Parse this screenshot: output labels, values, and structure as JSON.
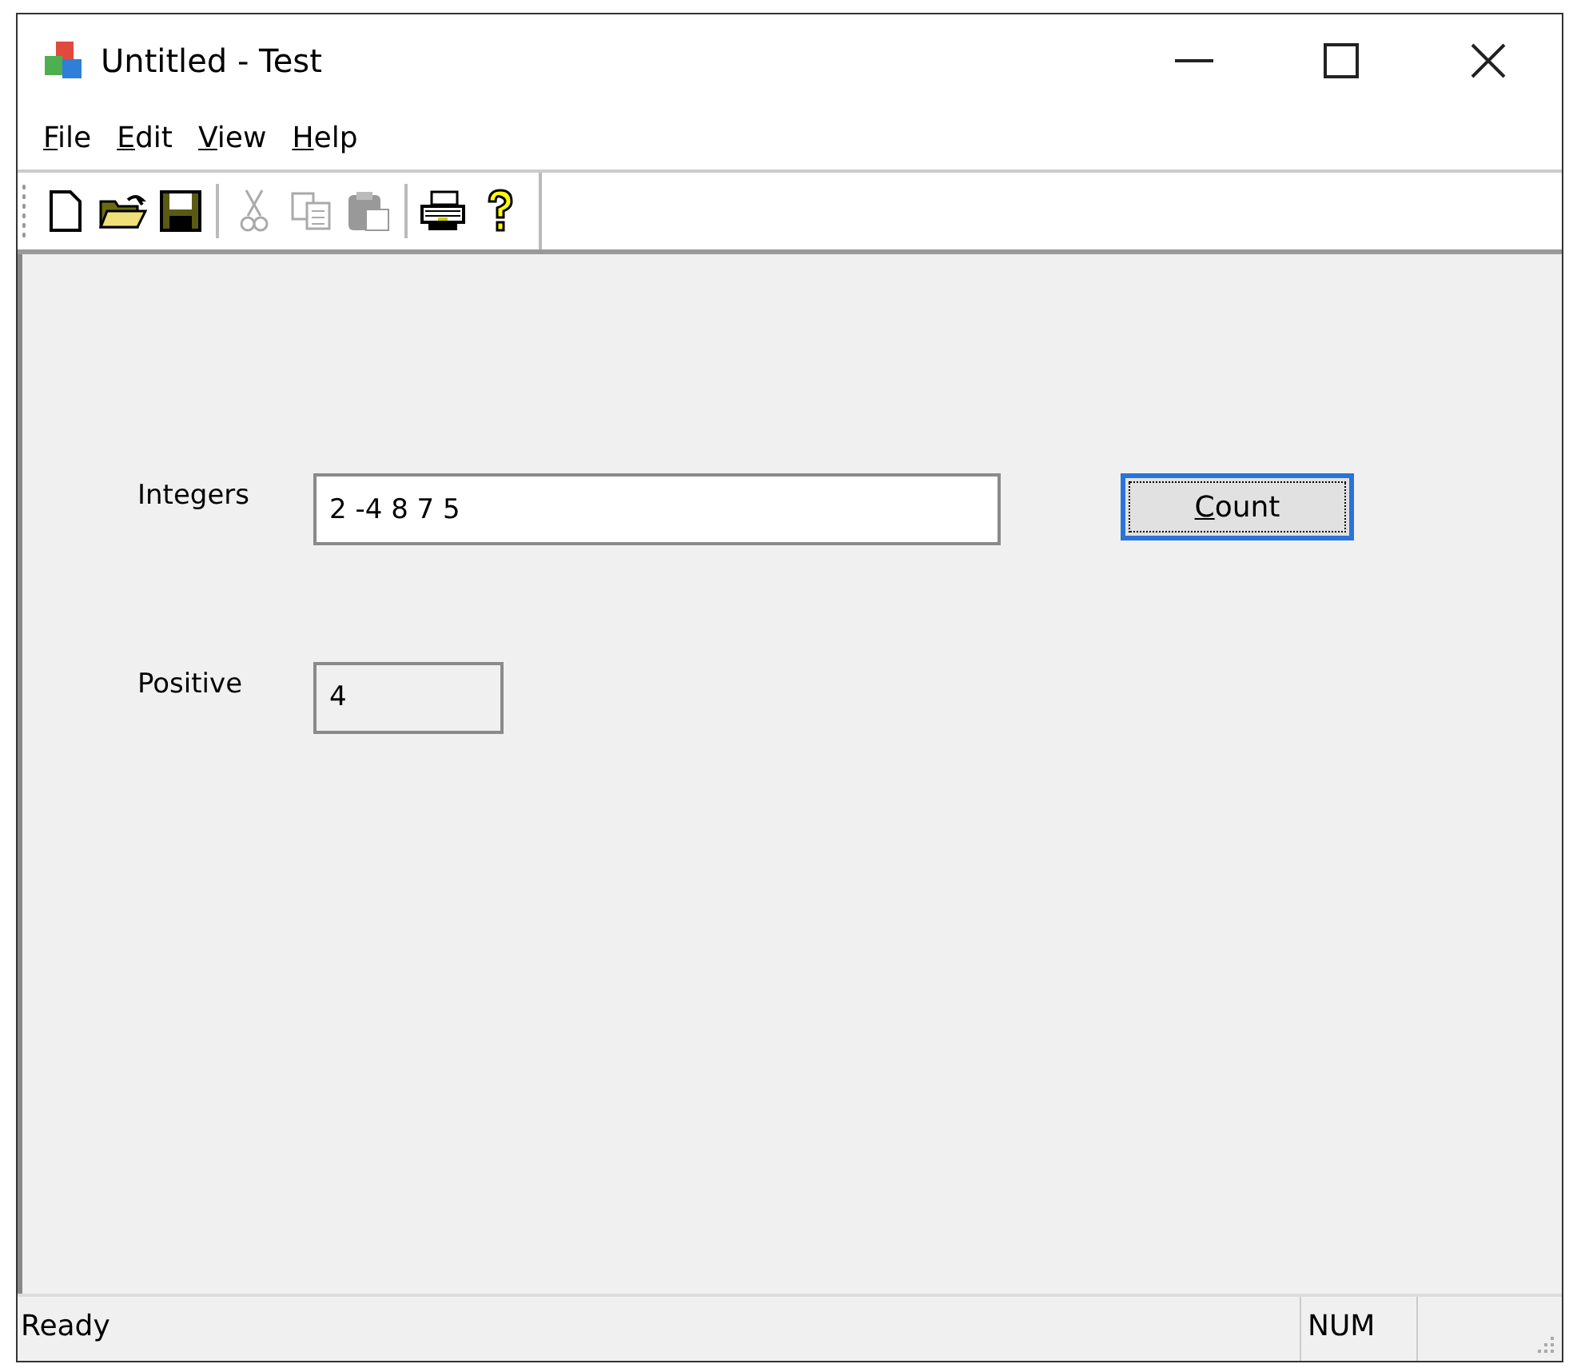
{
  "window": {
    "title": "Untitled - Test"
  },
  "menu": [
    {
      "accel": "F",
      "rest": "ile"
    },
    {
      "accel": "E",
      "rest": "dit"
    },
    {
      "accel": "V",
      "rest": "iew"
    },
    {
      "accel": "H",
      "rest": "elp"
    }
  ],
  "toolbar": [
    {
      "kind": "new",
      "disabled": false
    },
    {
      "kind": "open",
      "disabled": false
    },
    {
      "kind": "save",
      "disabled": false
    },
    {
      "kind": "separator"
    },
    {
      "kind": "cut",
      "disabled": true
    },
    {
      "kind": "copy",
      "disabled": true
    },
    {
      "kind": "paste",
      "disabled": true
    },
    {
      "kind": "separator"
    },
    {
      "kind": "print",
      "disabled": false
    },
    {
      "kind": "help",
      "disabled": false
    }
  ],
  "form": {
    "integers_label": "Integers",
    "integers_value": "2 -4 8 7 5",
    "count_button": {
      "accel": "C",
      "rest": "ount",
      "focused": true
    },
    "positive_label": "Positive",
    "positive_value": "4"
  },
  "status_bar": {
    "message": "Ready",
    "num": "NUM"
  }
}
